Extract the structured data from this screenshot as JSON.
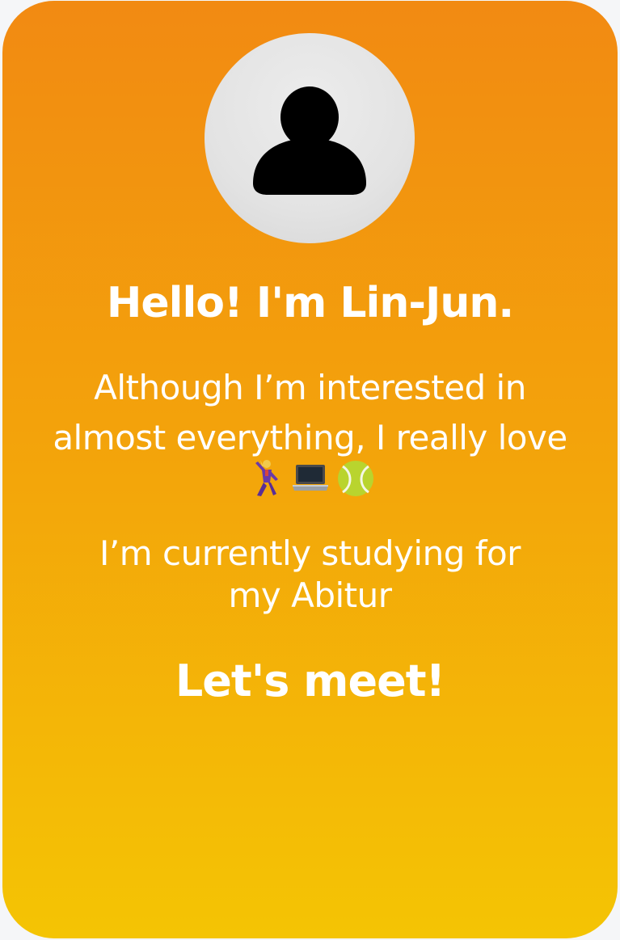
{
  "profile": {
    "avatar_icon": "person-silhouette-icon",
    "greeting": "Hello! I'm Lin-Jun.",
    "intro_line1": "Although I’m interested in",
    "intro_line2": "almost everything, I really love",
    "interests": [
      {
        "icon": "man-dancing-emoji"
      },
      {
        "icon": "laptop-emoji"
      },
      {
        "icon": "tennis-ball-emoji"
      }
    ],
    "study_line1": "I’m currently studying for",
    "study_line2": "my Abitur",
    "closing": "Let's meet!"
  },
  "colors": {
    "gradient_top": "#f28a12",
    "gradient_bottom": "#f4c404",
    "text": "#ffffff",
    "avatar_bg": "#e3e3e3",
    "avatar_figure": "#000000"
  }
}
